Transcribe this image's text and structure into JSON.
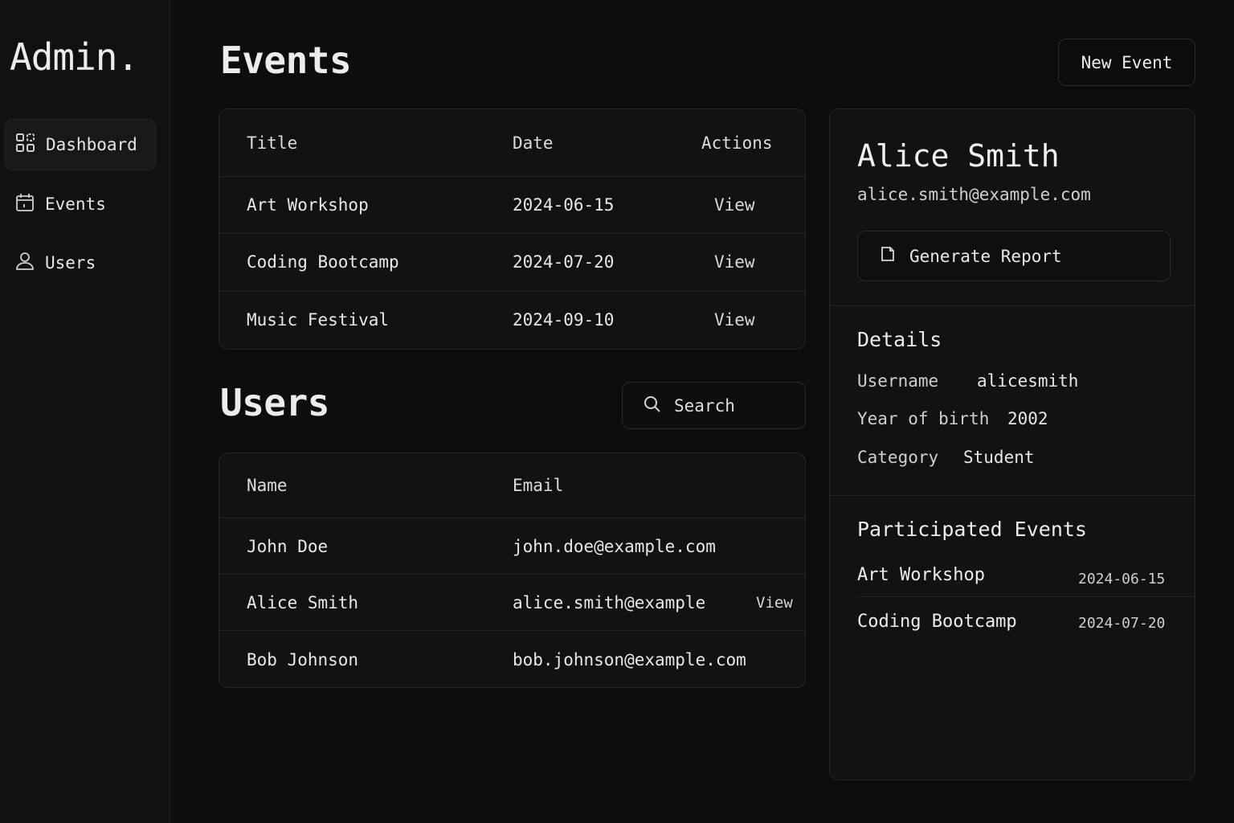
{
  "brand": "Admin.",
  "sidebar": {
    "items": [
      {
        "label": "Dashboard",
        "icon": "grid-icon",
        "active": true
      },
      {
        "label": "Events",
        "icon": "calendar-icon",
        "active": false
      },
      {
        "label": "Users",
        "icon": "user-icon",
        "active": false
      }
    ]
  },
  "events_section": {
    "title": "Events",
    "new_button": "New Event",
    "columns": [
      "Title",
      "Date",
      "Actions"
    ],
    "rows": [
      {
        "title": "Art Workshop",
        "date": "2024-06-15",
        "action": "View"
      },
      {
        "title": "Coding Bootcamp",
        "date": "2024-07-20",
        "action": "View"
      },
      {
        "title": "Music Festival",
        "date": "2024-09-10",
        "action": "View"
      }
    ]
  },
  "users_section": {
    "title": "Users",
    "search_placeholder": "Search",
    "columns": [
      "Name",
      "Email"
    ],
    "rows": [
      {
        "name": "John Doe",
        "email": "john.doe@example.com",
        "action": ""
      },
      {
        "name": "Alice Smith",
        "email": "alice.smith@example",
        "action": "View"
      },
      {
        "name": "Bob Johnson",
        "email": "bob.johnson@example.com",
        "action": ""
      }
    ]
  },
  "profile": {
    "name": "Alice Smith",
    "email": "alice.smith@example.com",
    "report_button": "Generate Report",
    "details_title": "Details",
    "details": [
      {
        "label": "Username",
        "value": "alicesmith"
      },
      {
        "label": "Year of birth",
        "value": "2002"
      },
      {
        "label": "Category",
        "value": "Student"
      }
    ],
    "participated_title": "Participated Events",
    "participated": [
      {
        "title": "Art Workshop",
        "date": "2024-06-15"
      },
      {
        "title": "Coding Bootcamp",
        "date": "2024-07-20"
      }
    ]
  },
  "colors": {
    "background": "#0d0d0d",
    "sidebar": "#111111",
    "card": "#121212",
    "border": "#262626",
    "text": "#e8e8e8"
  }
}
